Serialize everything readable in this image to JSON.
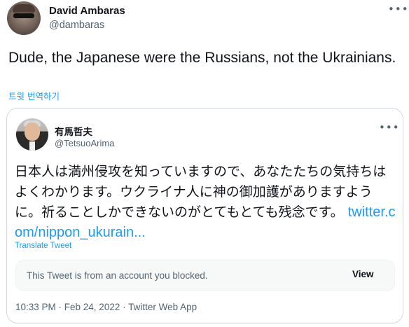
{
  "tweet": {
    "author_name": "David Ambaras",
    "author_handle": "@dambaras",
    "text": "Dude, the Japanese were the Russians, not the Ukrainians.",
    "translate_label": "트윗 번역하기",
    "more_icon": "more-horizontal-icon"
  },
  "quote": {
    "author_name": "有馬哲夫",
    "author_handle": "@TetsuoArima",
    "text": "日本人は満州侵攻を知っていますので、あなたたちの気持ちはよくわかります。ウクライナ人に神の御加護がありますように。祈ることしかできないのがとてもとても残念です。 ",
    "link_text": "twitter.com/nippon_ukurain...",
    "translate_label": "Translate Tweet",
    "blocked_message": "This Tweet is from an account you blocked.",
    "view_label": "View",
    "timestamp": "10:33 PM · Feb 24, 2022 · Twitter Web App",
    "more_icon": "more-horizontal-icon"
  },
  "colors": {
    "accent": "#1d9bf0",
    "secondary_text": "#536471",
    "border": "#cfd9de"
  }
}
